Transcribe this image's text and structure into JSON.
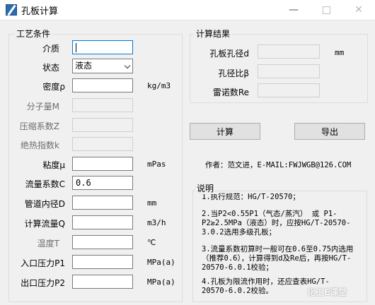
{
  "window": {
    "title": "孔板计算"
  },
  "input_group": {
    "legend": "工艺条件",
    "fields": [
      {
        "label": "介质",
        "value": "",
        "unit": "",
        "enabled": true
      },
      {
        "label": "状态",
        "value": "液态",
        "unit": "",
        "enabled": true,
        "type": "select"
      },
      {
        "label": "密度ρ",
        "value": "",
        "unit": "kg/m3",
        "enabled": true
      },
      {
        "label": "分子量M",
        "value": "",
        "unit": "",
        "enabled": false
      },
      {
        "label": "压缩系数Z",
        "value": "",
        "unit": "",
        "enabled": false
      },
      {
        "label": "绝热指数k",
        "value": "",
        "unit": "",
        "enabled": false
      },
      {
        "label": "粘度μ",
        "value": "",
        "unit": "mPas",
        "enabled": true
      },
      {
        "label": "流量系数C",
        "value": "0.6",
        "unit": "",
        "enabled": true
      },
      {
        "label": "管道内径D",
        "value": "",
        "unit": "mm",
        "enabled": true
      },
      {
        "label": "计算流量Q",
        "value": "",
        "unit": "m3/h",
        "enabled": true
      },
      {
        "label": "温度T",
        "value": "",
        "unit": "℃",
        "enabled": false
      },
      {
        "label": "入口压力P1",
        "value": "",
        "unit": "MPa(a)",
        "enabled": true
      },
      {
        "label": "出口压力P2",
        "value": "",
        "unit": "MPa(a)",
        "enabled": true
      }
    ]
  },
  "result_group": {
    "legend": "计算结果",
    "rows": [
      {
        "label": "孔板孔径d",
        "value": "",
        "unit": "mm"
      },
      {
        "label": "孔径比β",
        "value": "",
        "unit": ""
      },
      {
        "label": "雷诺数Re",
        "value": "",
        "unit": ""
      }
    ]
  },
  "buttons": {
    "calc": "计算",
    "export": "导出"
  },
  "author": "作者：范文进，E-MAIL:FWJWGB@126.COM",
  "notes": {
    "title": "说明",
    "items": [
      "1.执行规范：HG/T-20570；",
      "2.当P2<0.55P1（气态/蒸汽） 或  P1-P2≥2.5MPa（液态）时，应按HG/T-20570-3.0.2选用多级孔板；",
      "3.流量系数初算时一般可在0.6至0.75内选用（推荐0.6），计算得到d及Re后，再按HG/T-20570-6.0.1校验；",
      "4.孔板为限流作用时，还应查表HG/T-20570-6.0.2校验。"
    ]
  },
  "watermark": "化工E课堂"
}
